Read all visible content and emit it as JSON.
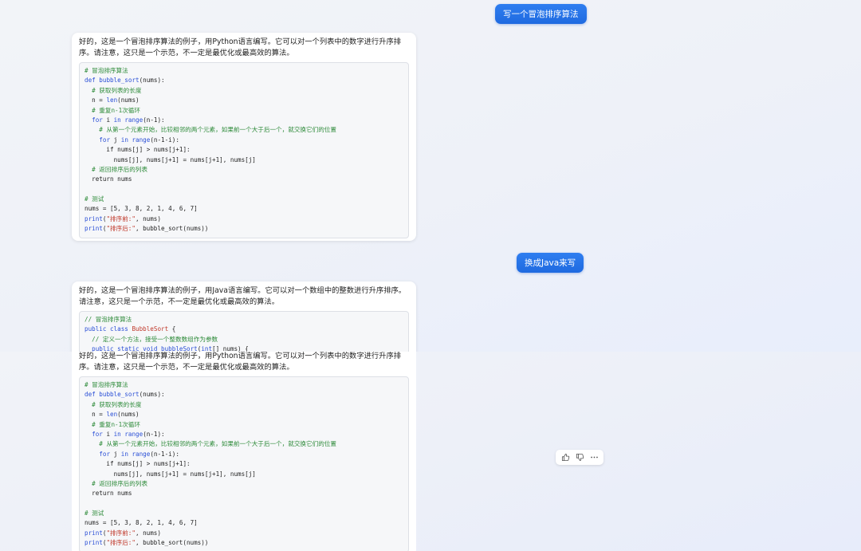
{
  "messages": {
    "user1": "写一个冒泡排序算法",
    "bot1_text": "好的，这是一个冒泡排序算法的例子，用Python语言编写。它可以对一个列表中的数字进行升序排序。请注意，这只是一个示范，不一定是最优化或最高效的算法。",
    "user2": "换成Java来写",
    "bot2_text": "好的，这是一个冒泡排序算法的例子，用Java语言编写。它可以对一个数组中的整数进行升序排序。请注意，这只是一个示范，不一定是最优化或最高效的算法。"
  },
  "python_code": [
    [
      [
        "c",
        "# 冒泡排序算法"
      ]
    ],
    [
      [
        "k",
        "def "
      ],
      [
        "f",
        "bubble_sort"
      ],
      [
        "p",
        "(nums):"
      ]
    ],
    [
      [
        "p",
        "  "
      ],
      [
        "c",
        "# 获取列表的长度"
      ]
    ],
    [
      [
        "p",
        "  n = "
      ],
      [
        "f",
        "len"
      ],
      [
        "p",
        "(nums)"
      ]
    ],
    [
      [
        "p",
        "  "
      ],
      [
        "c",
        "# 重复n-1次循环"
      ]
    ],
    [
      [
        "p",
        "  "
      ],
      [
        "k",
        "for "
      ],
      [
        "p",
        "i "
      ],
      [
        "k",
        "in "
      ],
      [
        "f",
        "range"
      ],
      [
        "p",
        "(n-1):"
      ]
    ],
    [
      [
        "p",
        "    "
      ],
      [
        "c",
        "# 从第一个元素开始，比较相邻的两个元素，如果前一个大于后一个，就交换它们的位置"
      ]
    ],
    [
      [
        "p",
        "    "
      ],
      [
        "k",
        "for "
      ],
      [
        "p",
        "j "
      ],
      [
        "k",
        "in "
      ],
      [
        "f",
        "range"
      ],
      [
        "p",
        "(n-1-i):"
      ]
    ],
    [
      [
        "p",
        "      if nums[j] > nums[j+1]:"
      ]
    ],
    [
      [
        "p",
        "        nums[j], nums[j+1] = nums[j+1], nums[j]"
      ]
    ],
    [
      [
        "p",
        "  "
      ],
      [
        "c",
        "# 返回排序后的列表"
      ]
    ],
    [
      [
        "p",
        "  return nums"
      ]
    ],
    [
      [
        "p",
        " "
      ]
    ],
    [
      [
        "c",
        "# 测试"
      ]
    ],
    [
      [
        "p",
        "nums = [5, 3, 8, 2, 1, 4, 6, 7]"
      ]
    ],
    [
      [
        "f",
        "print"
      ],
      [
        "p",
        "("
      ],
      [
        "s",
        "\"排序前:\""
      ],
      [
        "p",
        ", nums)"
      ]
    ],
    [
      [
        "f",
        "print"
      ],
      [
        "p",
        "("
      ],
      [
        "s",
        "\"排序后:\""
      ],
      [
        "p",
        ", bubble_sort(nums))"
      ]
    ]
  ],
  "java_code": [
    [
      [
        "c",
        "// 冒泡排序算法"
      ]
    ],
    [
      [
        "k",
        "public class "
      ],
      [
        "s",
        "BubbleSort"
      ],
      [
        "p",
        " {"
      ]
    ],
    [
      [
        "p",
        "  "
      ],
      [
        "c",
        "// 定义一个方法，接受一个整数数组作为参数"
      ]
    ],
    [
      [
        "p",
        "  "
      ],
      [
        "k",
        "public static void "
      ],
      [
        "f",
        "bubbleSort"
      ],
      [
        "p",
        "("
      ],
      [
        "k",
        "int"
      ],
      [
        "p",
        "[] nums) {"
      ]
    ]
  ],
  "actions": {
    "like": "thumbs-up-icon",
    "dislike": "thumbs-down-icon",
    "more": "more-icon"
  }
}
